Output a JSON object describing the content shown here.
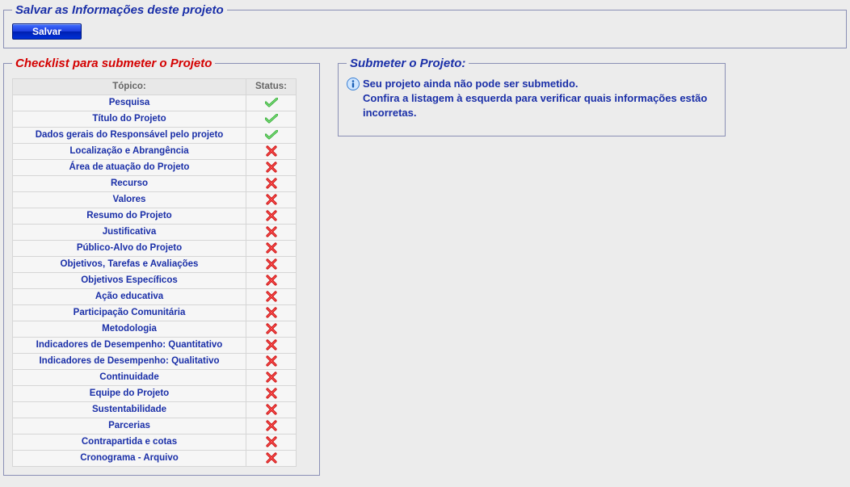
{
  "save_box": {
    "legend": "Salvar as Informações deste projeto",
    "save_label": "Salvar"
  },
  "checklist_box": {
    "legend": "Checklist para submeter o Projeto",
    "header_topic": "Tópico:",
    "header_status": "Status:",
    "items": [
      {
        "label": "Pesquisa",
        "ok": true
      },
      {
        "label": "Título do Projeto",
        "ok": true
      },
      {
        "label": "Dados gerais do Responsável pelo projeto",
        "ok": true
      },
      {
        "label": "Localização e Abrangência",
        "ok": false
      },
      {
        "label": "Área de atuação do Projeto",
        "ok": false
      },
      {
        "label": "Recurso",
        "ok": false
      },
      {
        "label": "Valores",
        "ok": false
      },
      {
        "label": "Resumo do Projeto",
        "ok": false
      },
      {
        "label": "Justificativa",
        "ok": false
      },
      {
        "label": "Público-Alvo do Projeto",
        "ok": false
      },
      {
        "label": "Objetivos, Tarefas e Avaliações",
        "ok": false
      },
      {
        "label": "Objetivos Específicos",
        "ok": false
      },
      {
        "label": "Ação educativa",
        "ok": false
      },
      {
        "label": "Participação Comunitária",
        "ok": false
      },
      {
        "label": "Metodologia",
        "ok": false
      },
      {
        "label": "Indicadores de Desempenho: Quantitativo",
        "ok": false
      },
      {
        "label": "Indicadores de Desempenho: Qualitativo",
        "ok": false
      },
      {
        "label": "Continuidade",
        "ok": false
      },
      {
        "label": "Equipe do Projeto",
        "ok": false
      },
      {
        "label": "Sustentabilidade",
        "ok": false
      },
      {
        "label": "Parcerias",
        "ok": false
      },
      {
        "label": "Contrapartida e cotas",
        "ok": false
      },
      {
        "label": "Cronograma - Arquivo",
        "ok": false
      }
    ]
  },
  "submit_box": {
    "legend": "Submeter o Projeto:",
    "message_line1": "Seu projeto ainda não pode ser submetido.",
    "message_line2": "Confira a listagem à esquerda para verificar quais informações estão incorretas."
  }
}
